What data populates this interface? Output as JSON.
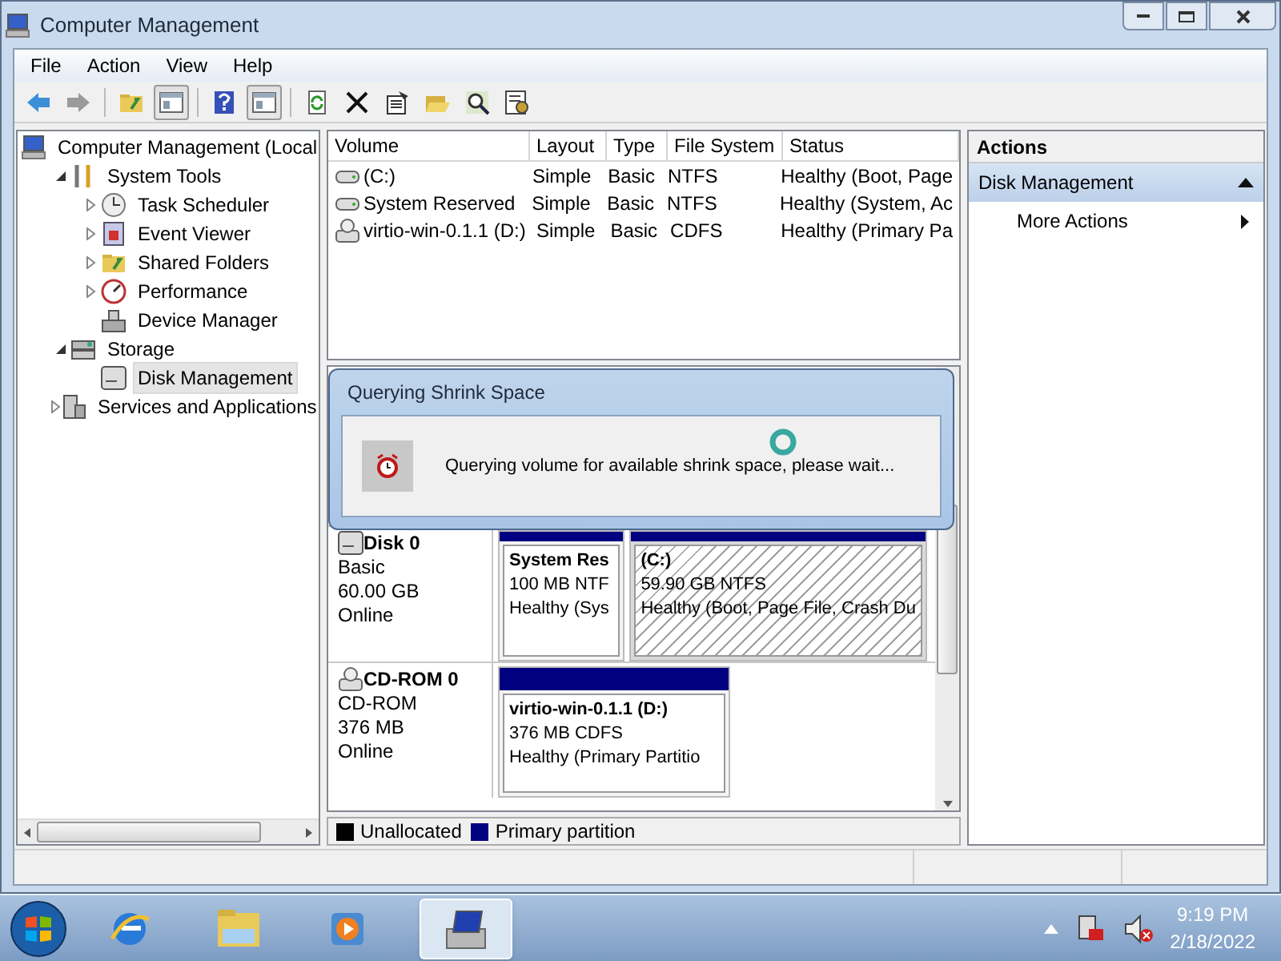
{
  "window": {
    "title": "Computer Management"
  },
  "menu": [
    "File",
    "Action",
    "View",
    "Help"
  ],
  "toolbar": [
    {
      "pressed": false
    },
    {
      "pressed": false
    },
    {
      "pressed": false
    },
    {
      "pressed": true
    },
    {
      "pressed": false
    },
    {
      "pressed": true
    },
    {
      "pressed": false
    },
    {
      "pressed": false
    },
    {
      "pressed": false
    },
    {
      "pressed": false
    },
    {
      "pressed": false
    },
    {
      "pressed": false
    }
  ],
  "tree": [
    {
      "label": "Computer Management (Local",
      "selected": false,
      "children": [
        {
          "label": "System Tools",
          "expanded": true,
          "selected": false,
          "children": [
            {
              "label": "Task Scheduler",
              "expanded": false,
              "selected": false
            },
            {
              "label": "Event Viewer",
              "expanded": false,
              "selected": false
            },
            {
              "label": "Shared Folders",
              "expanded": false,
              "selected": false
            },
            {
              "label": "Performance",
              "expanded": false,
              "selected": false
            },
            {
              "label": "Device Manager",
              "selected": false
            }
          ]
        },
        {
          "label": "Storage",
          "expanded": true,
          "selected": false,
          "children": [
            {
              "label": "Disk Management",
              "selected": true
            }
          ]
        },
        {
          "label": "Services and Applications",
          "expanded": false,
          "selected": false
        }
      ]
    }
  ],
  "volumes": {
    "columns": [
      "Volume",
      "Layout",
      "Type",
      "File System",
      "Status"
    ],
    "rows": [
      {
        "kind": "disk",
        "cells": [
          "(C:)",
          "Simple",
          "Basic",
          "NTFS",
          "Healthy (Boot, Page"
        ]
      },
      {
        "kind": "disk",
        "cells": [
          "System Reserved",
          "Simple",
          "Basic",
          "NTFS",
          "Healthy (System, Ac"
        ]
      },
      {
        "kind": "cd",
        "cells": [
          "virtio-win-0.1.1 (D:)",
          "Simple",
          "Basic",
          "CDFS",
          "Healthy (Primary Pa"
        ]
      }
    ]
  },
  "disks": [
    {
      "kind": "disk",
      "name": "Disk 0",
      "type": "Basic",
      "size": "60.00 GB",
      "status": "Online",
      "partitions": [
        {
          "name": "System Res",
          "size": "100 MB NTF",
          "status": "Healthy (Sys",
          "selected": false
        },
        {
          "name": "(C:)",
          "size": "59.90 GB NTFS",
          "status": "Healthy (Boot, Page File, Crash Du",
          "selected": true
        }
      ]
    },
    {
      "kind": "cd",
      "name": "CD-ROM 0",
      "type": "CD-ROM",
      "size": "376 MB",
      "status": "Online",
      "partitions": [
        {
          "name": "virtio-win-0.1.1  (D:)",
          "size": "376 MB CDFS",
          "status": "Healthy (Primary Partitio",
          "selected": false
        }
      ]
    }
  ],
  "legend": [
    {
      "label": "Unallocated",
      "color": "#000000"
    },
    {
      "label": "Primary partition",
      "color": "#000080"
    }
  ],
  "actions": {
    "title": "Actions",
    "section": "Disk Management",
    "expanded": true,
    "items": [
      "More Actions"
    ]
  },
  "dialog": {
    "title": "Querying Shrink Space",
    "message": "Querying volume for available shrink space, please wait..."
  },
  "taskbar": {
    "apps": [
      {
        "selected": false
      },
      {
        "selected": false
      },
      {
        "selected": false
      },
      {
        "selected": true
      }
    ],
    "time": "9:19 PM",
    "date": "2/18/2022"
  }
}
